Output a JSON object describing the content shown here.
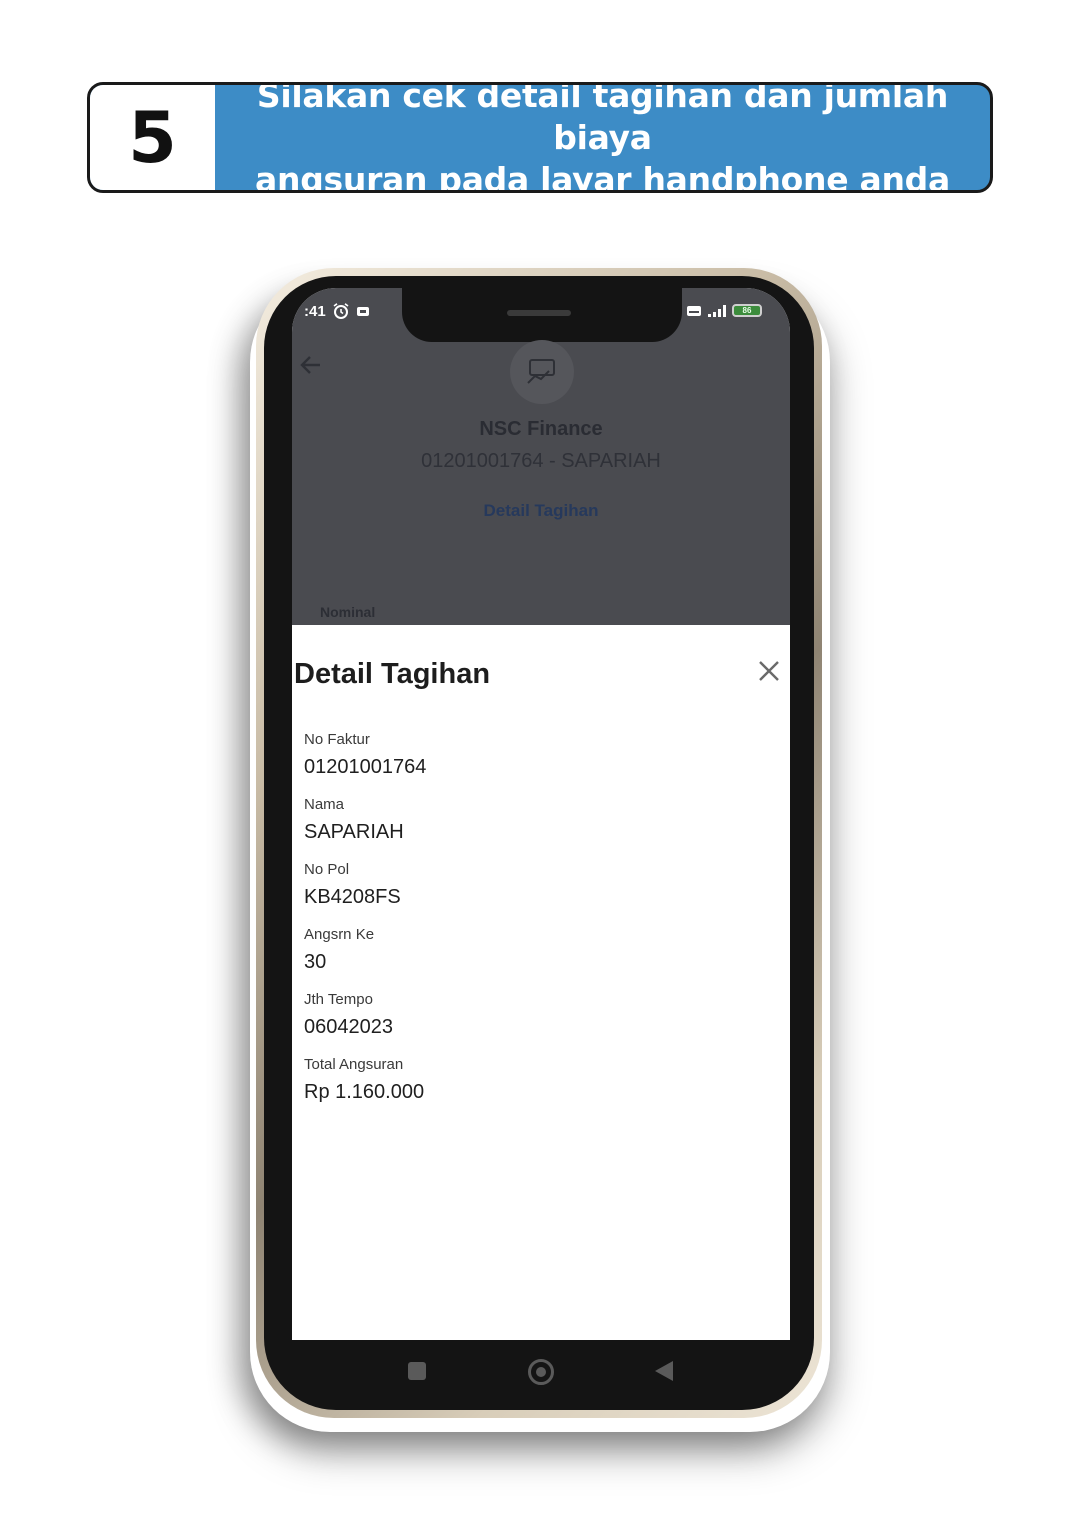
{
  "banner": {
    "step_number": "5",
    "line1": "Silakan cek detail tagihan dan jumlah biaya",
    "line2": "angsuran pada layar handphone anda"
  },
  "status_bar": {
    "time": ":41",
    "battery_level": "86"
  },
  "background_screen": {
    "biller_name": "NSC Finance",
    "biller_id": "01201001764 - SAPARIAH",
    "detail_link": "Detail Tagihan",
    "nominal_label": "Nominal"
  },
  "sheet": {
    "title": "Detail Tagihan",
    "fields": [
      {
        "label": "No Faktur",
        "value": "01201001764"
      },
      {
        "label": "Nama",
        "value": "SAPARIAH"
      },
      {
        "label": "No Pol",
        "value": "KB4208FS"
      },
      {
        "label": "Angsrn Ke",
        "value": "30"
      },
      {
        "label": "Jth Tempo",
        "value": "06042023"
      },
      {
        "label": "Total Angsuran",
        "value": "Rp 1.160.000"
      }
    ]
  },
  "colors": {
    "banner_blue": "#3d8cc6",
    "overlay_gray": "#4a4b50",
    "link_blue": "#26395c"
  },
  "icons": {
    "alarm": "alarm-icon",
    "back": "arrow-left-icon",
    "close": "close-icon",
    "logo": "biller-logo-icon"
  }
}
